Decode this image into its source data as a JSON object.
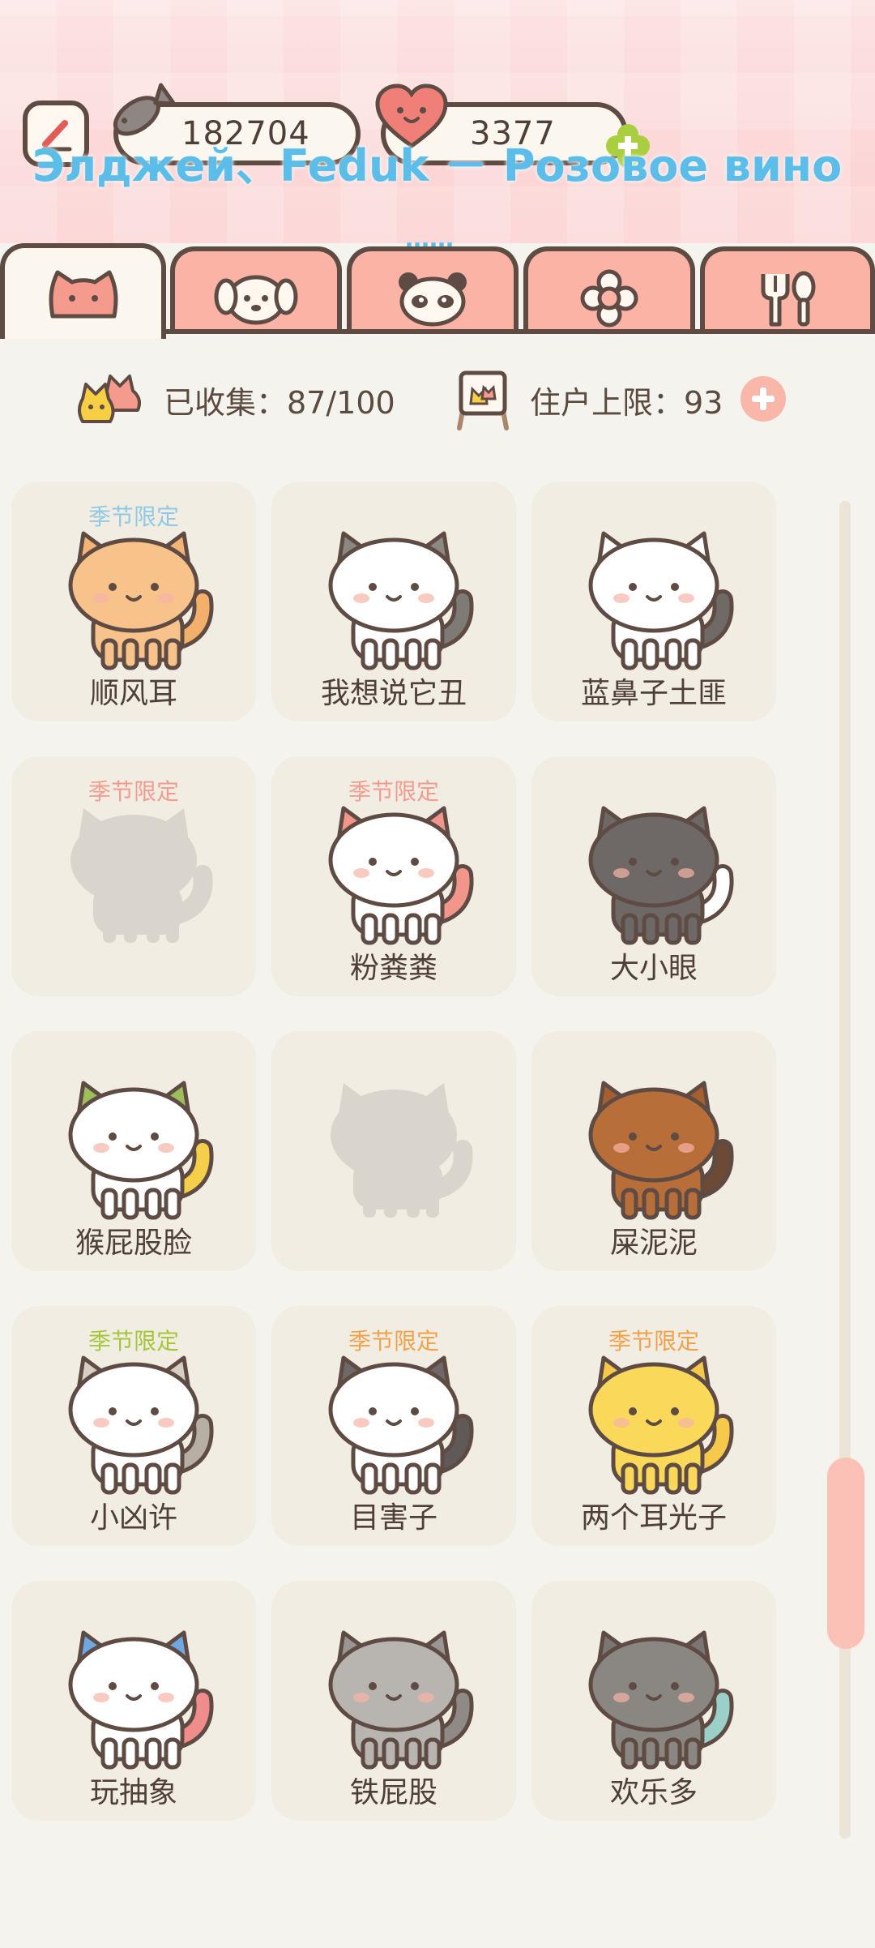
{
  "header": {
    "fish_count": "182704",
    "heart_count": "3377",
    "overlay_lyric": "Элджей、Feduk － Розовое вино",
    "overlay_dots": "……"
  },
  "tabs": [
    {
      "icon": "cat-face-icon",
      "active": true
    },
    {
      "icon": "dog-face-icon",
      "active": false
    },
    {
      "icon": "panda-face-icon",
      "active": false
    },
    {
      "icon": "flower-icon",
      "active": false
    },
    {
      "icon": "fork-spoon-icon",
      "active": false
    }
  ],
  "stats": {
    "collected_label": "已收集：87/100",
    "capacity_label": "住户上限：93"
  },
  "colors": {
    "seasonal_blue": "#8fc9e4",
    "seasonal_pink": "#f29c8f",
    "seasonal_green": "#a5c63b",
    "seasonal_orange": "#f0a24a"
  },
  "cats": [
    {
      "name": "顺风耳",
      "tag": "季节限定",
      "tag_color": "#8fc9e4",
      "body": "#f7c38a",
      "ears": "#f5b476",
      "tail": "#f3b06a",
      "locked": false
    },
    {
      "name": "我想说它丑",
      "tag": "",
      "tag_color": "",
      "body": "#ffffff",
      "ears": "#8c8985",
      "tail": "#7e7a76",
      "locked": false
    },
    {
      "name": "蓝鼻子土匪",
      "tag": "",
      "tag_color": "",
      "body": "#ffffff",
      "ears": "#ffffff",
      "tail": "#6f6a66",
      "locked": false
    },
    {
      "name": "",
      "tag": "季节限定",
      "tag_color": "#f29c8f",
      "body": "#d9d5cc",
      "ears": "#d9d5cc",
      "tail": "#d9d5cc",
      "locked": true
    },
    {
      "name": "粉粪粪",
      "tag": "季节限定",
      "tag_color": "#f29c8f",
      "body": "#ffffff",
      "ears": "#f2958a",
      "tail": "#f2958a",
      "locked": false
    },
    {
      "name": "大小眼",
      "tag": "",
      "tag_color": "",
      "body": "#6e6866",
      "ears": "#6e6866",
      "tail": "#ffffff",
      "locked": false
    },
    {
      "name": "猴屁股脸",
      "tag": "",
      "tag_color": "",
      "body": "#ffffff",
      "ears": "#9dbf5a",
      "tail": "#f5cf4a",
      "locked": false
    },
    {
      "name": "",
      "tag": "",
      "tag_color": "",
      "body": "#d9d5cc",
      "ears": "#d9d5cc",
      "tail": "#d9d5cc",
      "locked": true
    },
    {
      "name": "屎泥泥",
      "tag": "",
      "tag_color": "",
      "body": "#b86e38",
      "ears": "#a75f30",
      "tail": "#6d4a36",
      "locked": false
    },
    {
      "name": "小凶许",
      "tag": "季节限定",
      "tag_color": "#a5c63b",
      "body": "#ffffff",
      "ears": "#d7cfc4",
      "tail": "#b8afa4",
      "locked": false
    },
    {
      "name": "目害子",
      "tag": "季节限定",
      "tag_color": "#f0a24a",
      "body": "#ffffff",
      "ears": "#6e6866",
      "tail": "#5f5a58",
      "locked": false
    },
    {
      "name": "两个耳光子",
      "tag": "季节限定",
      "tag_color": "#f0a24a",
      "body": "#f9d85a",
      "ears": "#f7c94a",
      "tail": "#f7c94a",
      "locked": false
    },
    {
      "name": "玩抽象",
      "tag": "",
      "tag_color": "",
      "body": "#ffffff",
      "ears": "#6fa8e0",
      "tail": "#f08c8c",
      "locked": false
    },
    {
      "name": "铁屁股",
      "tag": "",
      "tag_color": "",
      "body": "#b8b4b0",
      "ears": "#9a9692",
      "tail": "#8f8a86",
      "locked": false
    },
    {
      "name": "欢乐多",
      "tag": "",
      "tag_color": "",
      "body": "#8a8782",
      "ears": "#7a7772",
      "tail": "#9ad0c8",
      "locked": false
    }
  ]
}
